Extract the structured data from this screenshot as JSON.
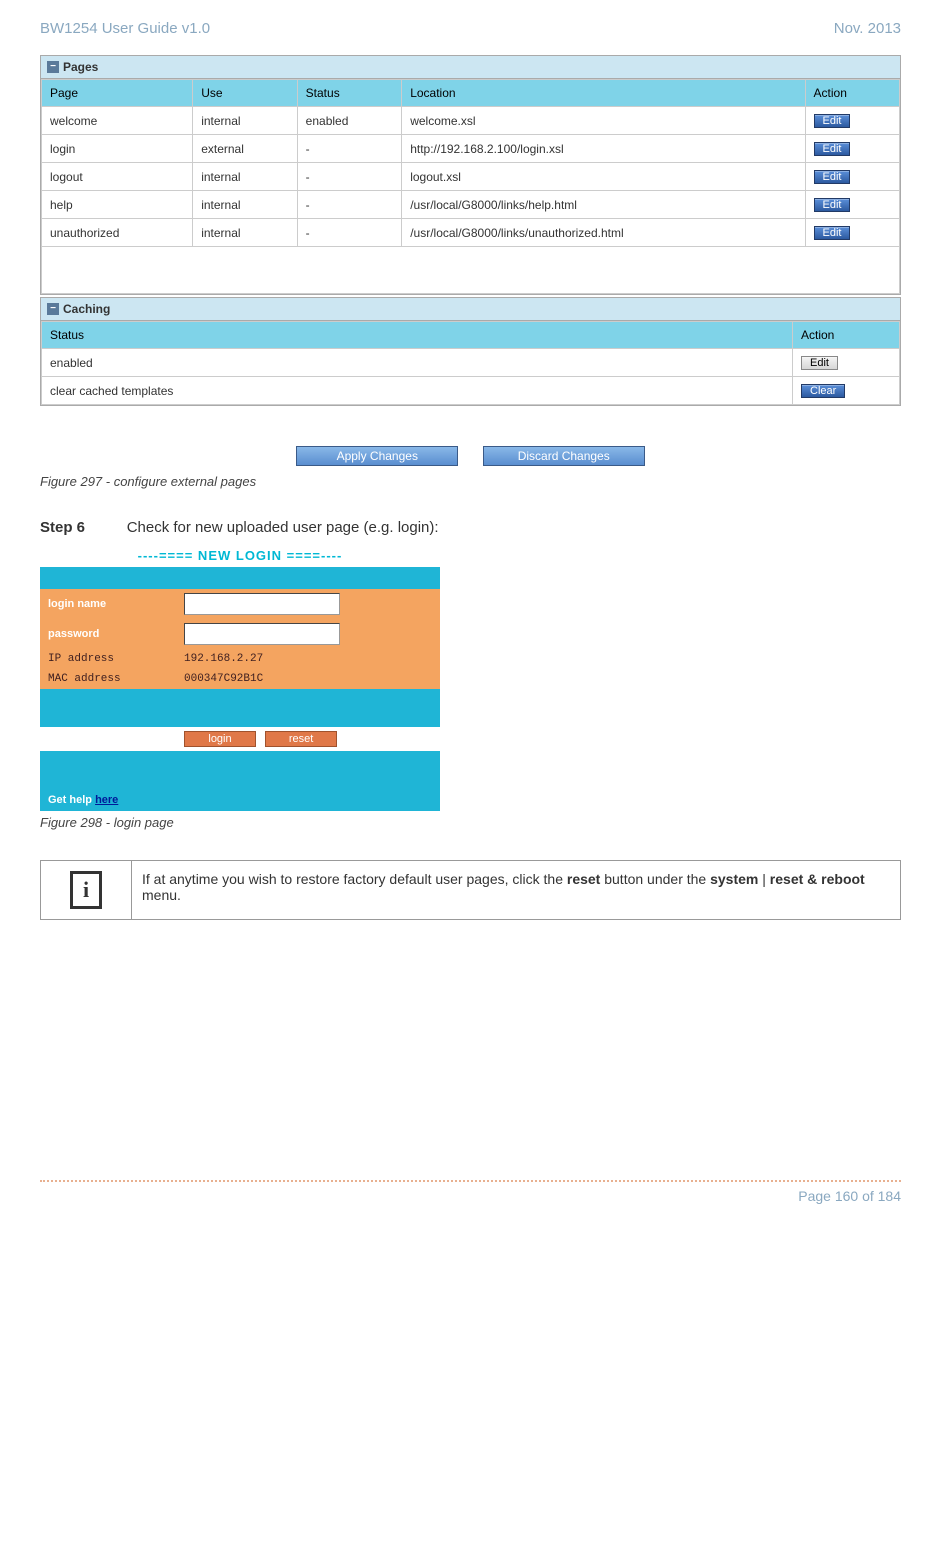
{
  "doc": {
    "header_left": "BW1254 User Guide v1.0",
    "header_right": "Nov.  2013",
    "footer": "Page 160 of 184"
  },
  "pages_panel": {
    "title": "Pages",
    "headers": [
      "Page",
      "Use",
      "Status",
      "Location",
      "Action"
    ],
    "rows": [
      {
        "page": "welcome",
        "use": "internal",
        "status": "enabled",
        "location": "welcome.xsl",
        "action": "Edit"
      },
      {
        "page": "login",
        "use": "external",
        "status": "-",
        "location": "http://192.168.2.100/login.xsl",
        "action": "Edit"
      },
      {
        "page": "logout",
        "use": "internal",
        "status": "-",
        "location": "logout.xsl",
        "action": "Edit"
      },
      {
        "page": "help",
        "use": "internal",
        "status": "-",
        "location": "/usr/local/G8000/links/help.html",
        "action": "Edit"
      },
      {
        "page": "unauthorized",
        "use": "internal",
        "status": "-",
        "location": "/usr/local/G8000/links/unauthorized.html",
        "action": "Edit"
      }
    ]
  },
  "caching_panel": {
    "title": "Caching",
    "headers": [
      "Status",
      "Action"
    ],
    "rows": [
      {
        "status": "enabled",
        "action": "Edit"
      },
      {
        "status": "clear cached templates",
        "action": "Clear"
      }
    ]
  },
  "buttons": {
    "apply": "Apply Changes",
    "discard": "Discard Changes"
  },
  "captions": {
    "fig297": "Figure 297 - configure external pages",
    "fig298": "Figure 298 - login page"
  },
  "step": {
    "label": "Step 6",
    "text": "Check for new uploaded user page (e.g. login):"
  },
  "login_page": {
    "title": "----==== NEW LOGIN ====----",
    "login_name_label": "login name",
    "password_label": "password",
    "ip_label": "IP address",
    "ip_value": "192.168.2.27",
    "mac_label": "MAC address",
    "mac_value": "000347C92B1C",
    "login_btn": "login",
    "reset_btn": "reset",
    "help_prefix": "Get help ",
    "help_link": "here"
  },
  "note": {
    "text_before": "If at anytime you wish to restore factory default user pages, click the ",
    "bold1": "reset",
    "text_mid": " button under the ",
    "bold2": "system",
    "text_sep": " | ",
    "bold3": "reset & reboot",
    "text_end": " menu."
  }
}
